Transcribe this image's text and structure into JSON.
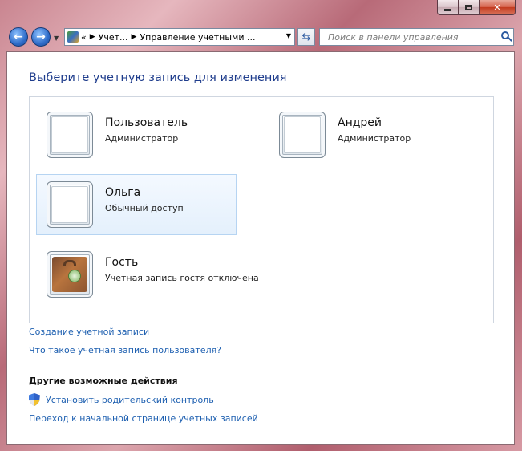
{
  "window": {
    "close_glyph": "✕"
  },
  "nav": {
    "back_glyph": "←",
    "forward_glyph": "→",
    "dropdown_glyph": "▼",
    "breadcrumb_prefix": "«",
    "breadcrumb": [
      "Учет...",
      "Управление учетными ..."
    ],
    "breadcrumb_sep": "▶",
    "address_dropdown_glyph": "▼",
    "refresh_glyph": "⇆",
    "search_placeholder": "Поиск в панели управления"
  },
  "main": {
    "title": "Выберите учетную запись для изменения",
    "accounts": [
      {
        "name": "Пользователь",
        "type": "Администратор",
        "selected": false,
        "icon": "blank-avatar-icon"
      },
      {
        "name": "Андрей",
        "type": "Администратор",
        "selected": false,
        "icon": "blank-avatar-icon"
      },
      {
        "name": "Ольга",
        "type": "Обычный доступ",
        "selected": true,
        "icon": "blank-avatar-icon"
      },
      {
        "name": "Гость",
        "type": "Учетная запись гостя отключена",
        "selected": false,
        "icon": "briefcase-icon"
      }
    ],
    "links": {
      "create_account": "Создание учетной записи",
      "what_is_account": "Что такое учетная запись пользователя?"
    },
    "other_actions": {
      "heading": "Другие возможные действия",
      "parental_control": "Установить родительский контроль",
      "accounts_home": "Переход к начальной странице учетных записей"
    }
  },
  "colors": {
    "link": "#1d5fb0",
    "title": "#1e3c8c",
    "selection": "#e4f0fc"
  }
}
